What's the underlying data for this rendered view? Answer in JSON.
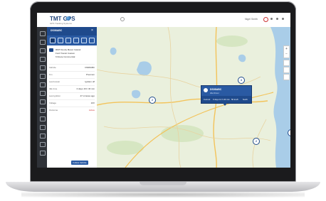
{
  "app": {
    "logo_text": "TMT GPS",
    "logo_tagline": "GPS Tracking Systems"
  },
  "topbar": {
    "user_text": "Nigel Smith"
  },
  "panel": {
    "title": "DS08ABC",
    "vehicle_lines": [
      "RMT Dundy Manor Ireland",
      "Ford Transit Custom",
      "6 Route Commercial"
    ],
    "rows": [
      {
        "key": "Vehicle",
        "value": "DS08ABC"
      },
      {
        "key": "Km",
        "value": "Premium"
      },
      {
        "key": "Last known",
        "value": "Ignition off"
      },
      {
        "key": "Idle time",
        "value": "0 days 16 h 30 min"
      },
      {
        "key": "Last ignition",
        "value": "47 minutes ago"
      },
      {
        "key": "Voltage",
        "value": "16V"
      },
      {
        "key": "Outcome",
        "value": "Active"
      }
    ],
    "button_label": "Follow Vehicle"
  },
  "popup": {
    "title": "DS08ABC",
    "subtitle": "Idle Driver",
    "cells": [
      "Current",
      "0 days 14 h 30 min",
      "56 km/h",
      "North"
    ]
  },
  "markers": [
    {
      "label": "2"
    },
    {
      "label": "3"
    },
    {
      "label": "3"
    },
    {
      "label": "2"
    },
    {
      "label": "4"
    },
    {
      "label": "5"
    }
  ],
  "zoom": {
    "in": "+",
    "out": "−"
  },
  "colors": {
    "brand": "#1f4a8c",
    "accent": "#2a5aa3",
    "nav_bg": "#2f3238",
    "alert": "#cc3333"
  }
}
